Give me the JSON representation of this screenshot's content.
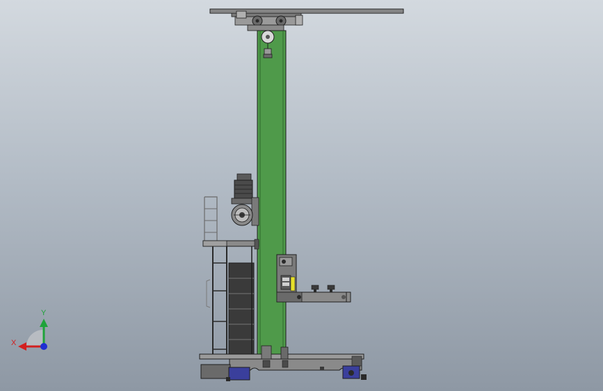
{
  "app": {
    "view": "front",
    "display_style": "shaded-with-edges"
  },
  "colors": {
    "background_top": "#d3d9df",
    "background_bottom": "#8e98a4",
    "column_green": "#4f9a4a",
    "steel": "#8f8f8f",
    "steel_dark": "#3a3a3a",
    "edge": "#1e1e1e",
    "motor_dark": "#4a4a4a",
    "accent_yellow": "#e6e02a",
    "blue_block": "#3a3f9c",
    "axis_x": "#d21f1f",
    "axis_y": "#1fa33a",
    "axis_z": "#1f2fd2"
  },
  "triad": {
    "x_label": "X",
    "y_label": "Y",
    "x_icon": "red-x-axis-arrow",
    "y_icon": "green-y-axis-arrow",
    "z_icon": "blue-z-axis-dot"
  }
}
